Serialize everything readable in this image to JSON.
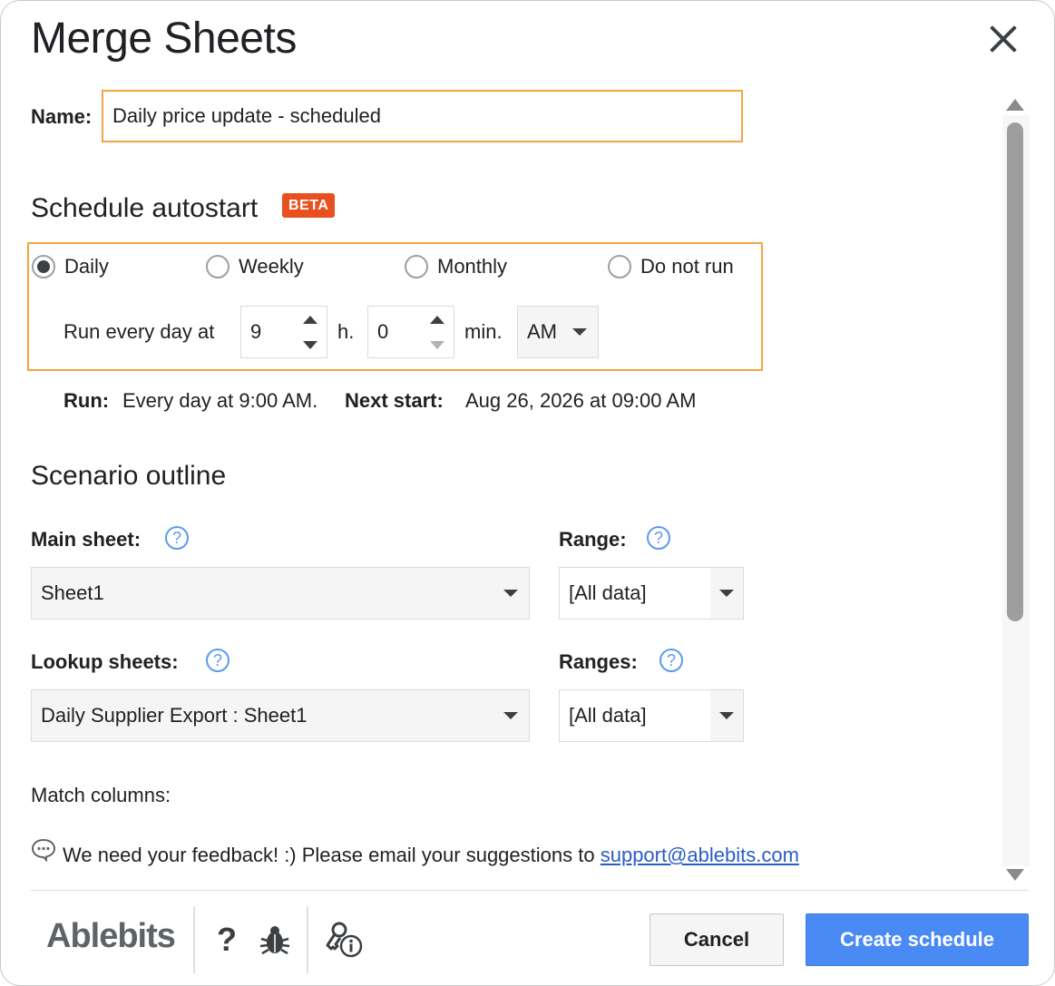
{
  "header": {
    "title": "Merge Sheets"
  },
  "name_field": {
    "label": "Name:",
    "value": "Daily price update - scheduled"
  },
  "schedule": {
    "heading": "Schedule autostart",
    "badge": "BETA",
    "options": [
      "Daily",
      "Weekly",
      "Monthly",
      "Do not run"
    ],
    "selected": "Daily",
    "run_every_label": "Run every day at",
    "hour": "9",
    "hour_unit": "h.",
    "minute": "0",
    "minute_unit": "min.",
    "ampm": "AM",
    "run_label": "Run:",
    "run_value": "Every day at 9:00 AM.",
    "next_label": "Next start:",
    "next_value": "Aug 26, 2026 at 09:00 AM"
  },
  "scenario": {
    "heading": "Scenario outline",
    "main_sheet_label": "Main sheet:",
    "main_sheet_value": "Sheet1",
    "range_label": "Range:",
    "range_value": "[All data]",
    "lookup_label": "Lookup sheets:",
    "lookup_value": "Daily Supplier Export : Sheet1",
    "ranges_label": "Ranges:",
    "ranges_value": "[All data]",
    "match_columns_label": "Match columns:",
    "help_glyph": "?"
  },
  "feedback": {
    "text": "We need your feedback! :) Please email your suggestions to",
    "email": "support@ablebits.com"
  },
  "footer": {
    "logo": "Ablebits",
    "help_glyph": "?",
    "cancel": "Cancel",
    "create": "Create schedule"
  },
  "colors": {
    "accent": "#f4a540",
    "primary_button": "#4a8af4",
    "beta_badge": "#e8501f",
    "help": "#5b9bf0"
  }
}
